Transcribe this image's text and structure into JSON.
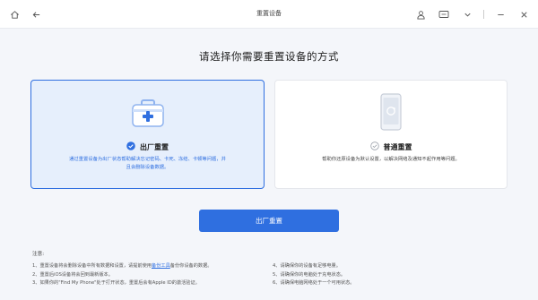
{
  "window": {
    "title": "重置设备"
  },
  "colors": {
    "accent": "#2f6fe0",
    "selected_bg": "#e6effc"
  },
  "icons": {
    "home": "home-icon",
    "back": "back-arrow-icon",
    "user": "user-icon",
    "feedback": "feedback-icon",
    "dropdown": "chevron-down-icon",
    "minimize": "minimize-icon",
    "close": "close-icon"
  },
  "heading": "请选择你需要重置设备的方式",
  "options": [
    {
      "title": "出厂重置",
      "description": "通过重置设备为出厂状态帮助解决忘记密码、卡死、冻结、卡顿等问题，并且会删除设备数据。",
      "selected": true,
      "icon": "first-aid-kit-icon"
    },
    {
      "title": "普通重置",
      "description": "帮助你还原设备为默认设置，以解决网络及通知不起作用等问题。",
      "selected": false,
      "icon": "phone-reset-icon"
    }
  ],
  "primary_button": "出厂重置",
  "notes": {
    "title": "注意:",
    "left": [
      {
        "pre": "1、重置设备将会删除设备中所有数据和设置，请提前使用",
        "link": "备份工具",
        "post": "备份你设备的数据。"
      },
      {
        "pre": "2、重置后iOS设备将会回到最新版本。",
        "link": "",
        "post": ""
      },
      {
        "pre": "3、如果你的\"Find My Phone\"处于打开状态，重置后会有Apple ID的激活验证。",
        "link": "",
        "post": ""
      }
    ],
    "right": [
      "4、请确保你的设备有足够电量。",
      "5、请确保你的电脑处于充电状态。",
      "6、请确保电脑网络处于一个可用状态。"
    ]
  }
}
